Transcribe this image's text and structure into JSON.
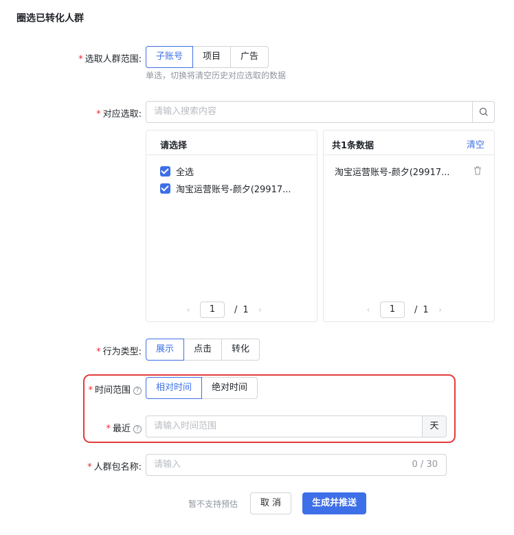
{
  "title": "圈选已转化人群",
  "form": {
    "required_mark": "*",
    "scope": {
      "label": "选取人群范围:",
      "options": [
        "子账号",
        "项目",
        "广告"
      ],
      "selected": "子账号",
      "hint": "单选，切换将清空历史对应选取的数据"
    },
    "match": {
      "label": "对应选取:",
      "placeholder": "请输入搜索内容",
      "search_icon": "search-icon"
    },
    "left_panel": {
      "header": "请选择",
      "items": [
        {
          "label": "全选",
          "checked": true
        },
        {
          "label": "淘宝运营账号-颜夕(29917...",
          "checked": true
        }
      ],
      "pager": {
        "prev": "‹",
        "current": "1",
        "sep": "/",
        "total": "1",
        "next": "›"
      }
    },
    "right_panel": {
      "header": "共1条数据",
      "clear": "清空",
      "items": [
        {
          "label": "淘宝运营账号-颜夕(29917...",
          "icon": "trash-icon"
        }
      ],
      "pager": {
        "prev": "‹",
        "current": "1",
        "sep": "/",
        "total": "1",
        "next": "›"
      }
    },
    "behavior": {
      "label": "行为类型:",
      "options": [
        "展示",
        "点击",
        "转化"
      ],
      "selected": "展示"
    },
    "time_range": {
      "label": "时间范围",
      "help": "?",
      "options": [
        "相对时间",
        "绝对时间"
      ],
      "selected": "相对时间"
    },
    "recent": {
      "label": "最近",
      "help": "?",
      "placeholder": "请输入时间范围",
      "suffix": "天"
    },
    "package_name": {
      "label": "人群包名称:",
      "placeholder": "请输入",
      "count": "0 / 30"
    }
  },
  "footer": {
    "note": "暂不支持预估",
    "cancel": "取 消",
    "submit": "生成并推送"
  },
  "colors": {
    "primary": "#3d6fe8",
    "required": "#f5222d",
    "highlight": "#e33b3b"
  }
}
